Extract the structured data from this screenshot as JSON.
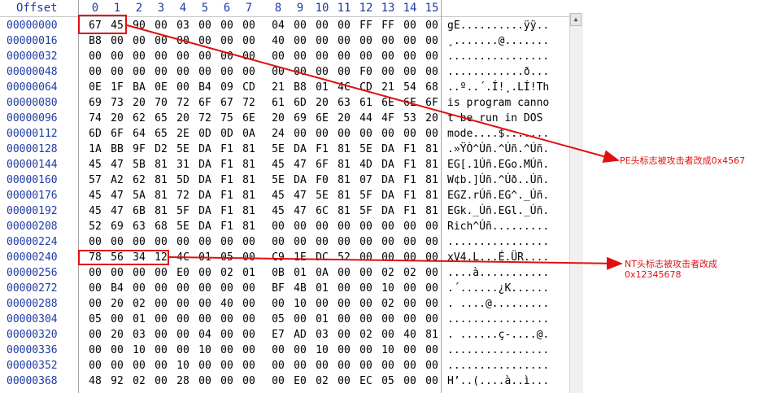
{
  "header": {
    "offset_label": "Offset",
    "columns": [
      "0",
      "1",
      "2",
      "3",
      "4",
      "5",
      "6",
      "7",
      "8",
      "9",
      "10",
      "11",
      "12",
      "13",
      "14",
      "15"
    ]
  },
  "rows": [
    {
      "offset": "00000000",
      "bytes": [
        "67",
        "45",
        "90",
        "00",
        "03",
        "00",
        "00",
        "00",
        "04",
        "00",
        "00",
        "00",
        "FF",
        "FF",
        "00",
        "00"
      ],
      "ascii": "gE..........ÿÿ.."
    },
    {
      "offset": "00000016",
      "bytes": [
        "B8",
        "00",
        "00",
        "00",
        "00",
        "00",
        "00",
        "00",
        "40",
        "00",
        "00",
        "00",
        "00",
        "00",
        "00",
        "00"
      ],
      "ascii": "¸.......@......."
    },
    {
      "offset": "00000032",
      "bytes": [
        "00",
        "00",
        "00",
        "00",
        "00",
        "00",
        "00",
        "00",
        "00",
        "00",
        "00",
        "00",
        "00",
        "00",
        "00",
        "00"
      ],
      "ascii": "................"
    },
    {
      "offset": "00000048",
      "bytes": [
        "00",
        "00",
        "00",
        "00",
        "00",
        "00",
        "00",
        "00",
        "00",
        "00",
        "00",
        "00",
        "F0",
        "00",
        "00",
        "00"
      ],
      "ascii": "............ð..."
    },
    {
      "offset": "00000064",
      "bytes": [
        "0E",
        "1F",
        "BA",
        "0E",
        "00",
        "B4",
        "09",
        "CD",
        "21",
        "B8",
        "01",
        "4C",
        "CD",
        "21",
        "54",
        "68"
      ],
      "ascii": "..º..´.Í!¸.LÍ!Th"
    },
    {
      "offset": "00000080",
      "bytes": [
        "69",
        "73",
        "20",
        "70",
        "72",
        "6F",
        "67",
        "72",
        "61",
        "6D",
        "20",
        "63",
        "61",
        "6E",
        "6E",
        "6F"
      ],
      "ascii": "is program canno"
    },
    {
      "offset": "00000096",
      "bytes": [
        "74",
        "20",
        "62",
        "65",
        "20",
        "72",
        "75",
        "6E",
        "20",
        "69",
        "6E",
        "20",
        "44",
        "4F",
        "53",
        "20"
      ],
      "ascii": "t be run in DOS "
    },
    {
      "offset": "00000112",
      "bytes": [
        "6D",
        "6F",
        "64",
        "65",
        "2E",
        "0D",
        "0D",
        "0A",
        "24",
        "00",
        "00",
        "00",
        "00",
        "00",
        "00",
        "00"
      ],
      "ascii": "mode....$......."
    },
    {
      "offset": "00000128",
      "bytes": [
        "1A",
        "BB",
        "9F",
        "D2",
        "5E",
        "DA",
        "F1",
        "81",
        "5E",
        "DA",
        "F1",
        "81",
        "5E",
        "DA",
        "F1",
        "81"
      ],
      "ascii": ".»ŸÒ^Úñ.^Úñ.^Úñ."
    },
    {
      "offset": "00000144",
      "bytes": [
        "45",
        "47",
        "5B",
        "81",
        "31",
        "DA",
        "F1",
        "81",
        "45",
        "47",
        "6F",
        "81",
        "4D",
        "DA",
        "F1",
        "81"
      ],
      "ascii": "EG[.1Úñ.EGo.MÚñ."
    },
    {
      "offset": "00000160",
      "bytes": [
        "57",
        "A2",
        "62",
        "81",
        "5D",
        "DA",
        "F1",
        "81",
        "5E",
        "DA",
        "F0",
        "81",
        "07",
        "DA",
        "F1",
        "81"
      ],
      "ascii": "W¢b.]Úñ.^Úð..Úñ."
    },
    {
      "offset": "00000176",
      "bytes": [
        "45",
        "47",
        "5A",
        "81",
        "72",
        "DA",
        "F1",
        "81",
        "45",
        "47",
        "5E",
        "81",
        "5F",
        "DA",
        "F1",
        "81"
      ],
      "ascii": "EGZ.rÚñ.EG^._Úñ."
    },
    {
      "offset": "00000192",
      "bytes": [
        "45",
        "47",
        "6B",
        "81",
        "5F",
        "DA",
        "F1",
        "81",
        "45",
        "47",
        "6C",
        "81",
        "5F",
        "DA",
        "F1",
        "81"
      ],
      "ascii": "EGk._Úñ.EGl._Úñ."
    },
    {
      "offset": "00000208",
      "bytes": [
        "52",
        "69",
        "63",
        "68",
        "5E",
        "DA",
        "F1",
        "81",
        "00",
        "00",
        "00",
        "00",
        "00",
        "00",
        "00",
        "00"
      ],
      "ascii": "Rich^Úñ........."
    },
    {
      "offset": "00000224",
      "bytes": [
        "00",
        "00",
        "00",
        "00",
        "00",
        "00",
        "00",
        "00",
        "00",
        "00",
        "00",
        "00",
        "00",
        "00",
        "00",
        "00"
      ],
      "ascii": "................"
    },
    {
      "offset": "00000240",
      "bytes": [
        "78",
        "56",
        "34",
        "12",
        "4C",
        "01",
        "05",
        "00",
        "C9",
        "1E",
        "DC",
        "52",
        "00",
        "00",
        "00",
        "00"
      ],
      "ascii": "xV4.L...É.ÜR...."
    },
    {
      "offset": "00000256",
      "bytes": [
        "00",
        "00",
        "00",
        "00",
        "E0",
        "00",
        "02",
        "01",
        "0B",
        "01",
        "0A",
        "00",
        "00",
        "02",
        "02",
        "00"
      ],
      "ascii": "....à..........."
    },
    {
      "offset": "00000272",
      "bytes": [
        "00",
        "B4",
        "00",
        "00",
        "00",
        "00",
        "00",
        "00",
        "BF",
        "4B",
        "01",
        "00",
        "00",
        "10",
        "00",
        "00"
      ],
      "ascii": ".´......¿K......"
    },
    {
      "offset": "00000288",
      "bytes": [
        "00",
        "20",
        "02",
        "00",
        "00",
        "00",
        "40",
        "00",
        "00",
        "10",
        "00",
        "00",
        "00",
        "02",
        "00",
        "00"
      ],
      "ascii": ". ....@........."
    },
    {
      "offset": "00000304",
      "bytes": [
        "05",
        "00",
        "01",
        "00",
        "00",
        "00",
        "00",
        "00",
        "05",
        "00",
        "01",
        "00",
        "00",
        "00",
        "00",
        "00"
      ],
      "ascii": "................"
    },
    {
      "offset": "00000320",
      "bytes": [
        "00",
        "20",
        "03",
        "00",
        "00",
        "04",
        "00",
        "00",
        "E7",
        "AD",
        "03",
        "00",
        "02",
        "00",
        "40",
        "81"
      ],
      "ascii": ". ......ç-....@."
    },
    {
      "offset": "00000336",
      "bytes": [
        "00",
        "00",
        "10",
        "00",
        "00",
        "10",
        "00",
        "00",
        "00",
        "00",
        "10",
        "00",
        "00",
        "10",
        "00",
        "00"
      ],
      "ascii": "................"
    },
    {
      "offset": "00000352",
      "bytes": [
        "00",
        "00",
        "00",
        "00",
        "10",
        "00",
        "00",
        "00",
        "00",
        "00",
        "00",
        "00",
        "00",
        "00",
        "00",
        "00"
      ],
      "ascii": "................"
    },
    {
      "offset": "00000368",
      "bytes": [
        "48",
        "92",
        "02",
        "00",
        "28",
        "00",
        "00",
        "00",
        "00",
        "E0",
        "02",
        "00",
        "EC",
        "05",
        "00",
        "00"
      ],
      "ascii": "H’..(....à..ì..."
    }
  ],
  "annotations": {
    "pe": "PE头标志被攻击者改成0x4567",
    "nt_line1": "NT头标志被攻击者改成",
    "nt_line2": "0x12345678"
  },
  "colors": {
    "offset": "#1f3ba6",
    "annotation": "#e01010"
  }
}
